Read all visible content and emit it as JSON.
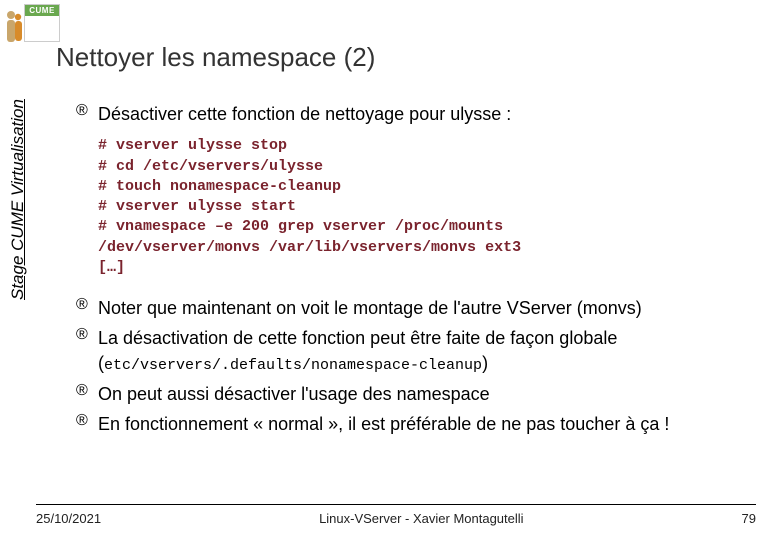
{
  "logo": {
    "brand": "CUME"
  },
  "title": "Nettoyer les namespace (2)",
  "sidebar_label": "Stage CUME Virtualisation",
  "bullets": {
    "b1": "Désactiver cette fonction de nettoyage pour ulysse :",
    "b2": "Noter que maintenant on voit le montage de l'autre VServer (monvs)",
    "b3_pre": "La désactivation de cette fonction peut être faite de façon globale (",
    "b3_code": "etc/vservers/.defaults/nonamespace-cleanup",
    "b3_post": ")",
    "b4": "On peut aussi désactiver l'usage des namespace",
    "b5": "En fonctionnement « normal », il est préférable de ne pas toucher à ça !"
  },
  "code": "# vserver ulysse stop\n# cd /etc/vservers/ulysse\n# touch nonamespace-cleanup\n# vserver ulysse start\n# vnamespace –e 200 grep vserver /proc/mounts\n/dev/vserver/monvs /var/lib/vservers/monvs ext3\n[…]",
  "footer": {
    "date": "25/10/2021",
    "center": "Linux-VServer - Xavier Montagutelli",
    "page": "79"
  }
}
